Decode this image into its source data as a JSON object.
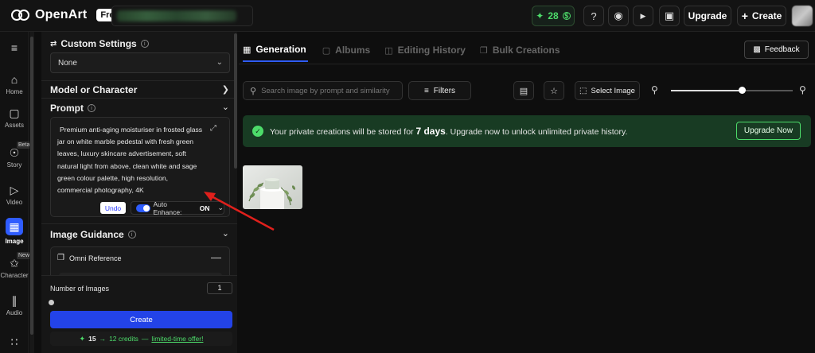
{
  "app": {
    "brand": "OpenArt",
    "plan_badge": "Free"
  },
  "topbar": {
    "credits": "28",
    "upgrade_label": "Upgrade",
    "create_label": "Create"
  },
  "nav": {
    "items": [
      {
        "label": "Home",
        "icon": "home-icon"
      },
      {
        "label": "Assets",
        "icon": "folder-icon"
      },
      {
        "label": "Story",
        "icon": "film-reel-icon",
        "badge": "Beta"
      },
      {
        "label": "Video",
        "icon": "video-icon"
      },
      {
        "label": "Image",
        "icon": "image-icon",
        "active": true
      },
      {
        "label": "Character",
        "icon": "sparkle-character-icon",
        "badge": "New"
      },
      {
        "label": "Audio",
        "icon": "waveform-icon"
      }
    ]
  },
  "panel": {
    "custom_settings": {
      "title": "Custom Settings",
      "selected": "None"
    },
    "model_title": "Model or Character",
    "prompt": {
      "title": "Prompt",
      "lines": [
        "Premium anti-aging moisturiser in frosted glass",
        "jar on white marble pedestal with fresh green",
        "leaves, luxury skincare advertisement, soft",
        "natural light from above, clean white and sage",
        "green colour palette, high resolution,",
        "commercial photography, 4K"
      ],
      "undo_label": "Undo",
      "auto_enhance_label": "Auto Enhance:",
      "auto_enhance_value": "ON",
      "auto_enhance_on": true
    },
    "image_guidance": {
      "title": "Image Guidance",
      "omni_label": "Omni Reference"
    },
    "number_of_images": {
      "label": "Number of Images",
      "value": "1"
    },
    "create_label": "Create",
    "offer": {
      "from": "15",
      "arrow": "→",
      "to": "12 credits",
      "dash": " —",
      "link": "limited-time offer!"
    }
  },
  "main": {
    "tabs": [
      {
        "label": "Generation",
        "active": true,
        "icon": "image-icon"
      },
      {
        "label": "Albums",
        "active": false,
        "icon": "folder-icon"
      },
      {
        "label": "Editing History",
        "active": false,
        "icon": "history-icon"
      },
      {
        "label": "Bulk Creations",
        "active": false,
        "icon": "stack-icon"
      }
    ],
    "feedback_label": "Feedback",
    "search_placeholder": "Search image by prompt and similarity",
    "filters_label": "Filters",
    "select_image_label": "Select Image",
    "zoom_level": 0.58,
    "banner": {
      "text_before": "Your private creations will be stored for ",
      "days": "7 days",
      "text_after": ". Upgrade now to unlock unlimited private history.",
      "button": "Upgrade Now"
    }
  },
  "colors": {
    "accent": "#2f5cff",
    "create_button": "#2343e8",
    "credit_green": "#4ddc6a",
    "banner_bg": "#183b23",
    "annotation_arrow": "#e0201c"
  }
}
